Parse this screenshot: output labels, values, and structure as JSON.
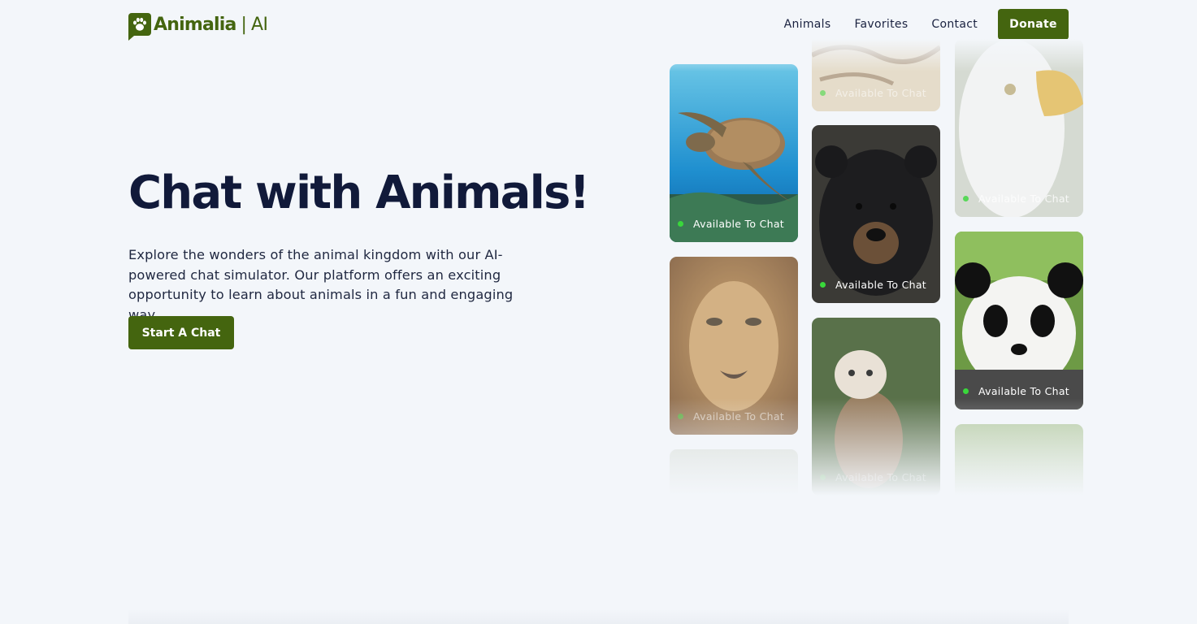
{
  "brand": {
    "name": "Animalia",
    "separator": "|",
    "suffix": "AI",
    "color": "#44650f"
  },
  "nav": {
    "links": [
      "Animals",
      "Favorites",
      "Contact"
    ],
    "donate_label": "Donate"
  },
  "hero": {
    "title": "Chat with Animals!",
    "description": "Explore the wonders of the animal kingdom with our AI-powered chat simulator. Our platform offers an exciting opportunity to learn about animals in a fun and engaging way.",
    "cta_label": "Start A Chat"
  },
  "gallery": {
    "status_label": "Available To Chat",
    "status_color": "#39d83b",
    "cards": [
      {
        "animal": "sea-turtle"
      },
      {
        "animal": "lion"
      },
      {
        "animal": "tiger"
      },
      {
        "animal": "black-bear"
      },
      {
        "animal": "barn-owl"
      },
      {
        "animal": "bald-eagle"
      },
      {
        "animal": "giant-panda"
      }
    ]
  }
}
